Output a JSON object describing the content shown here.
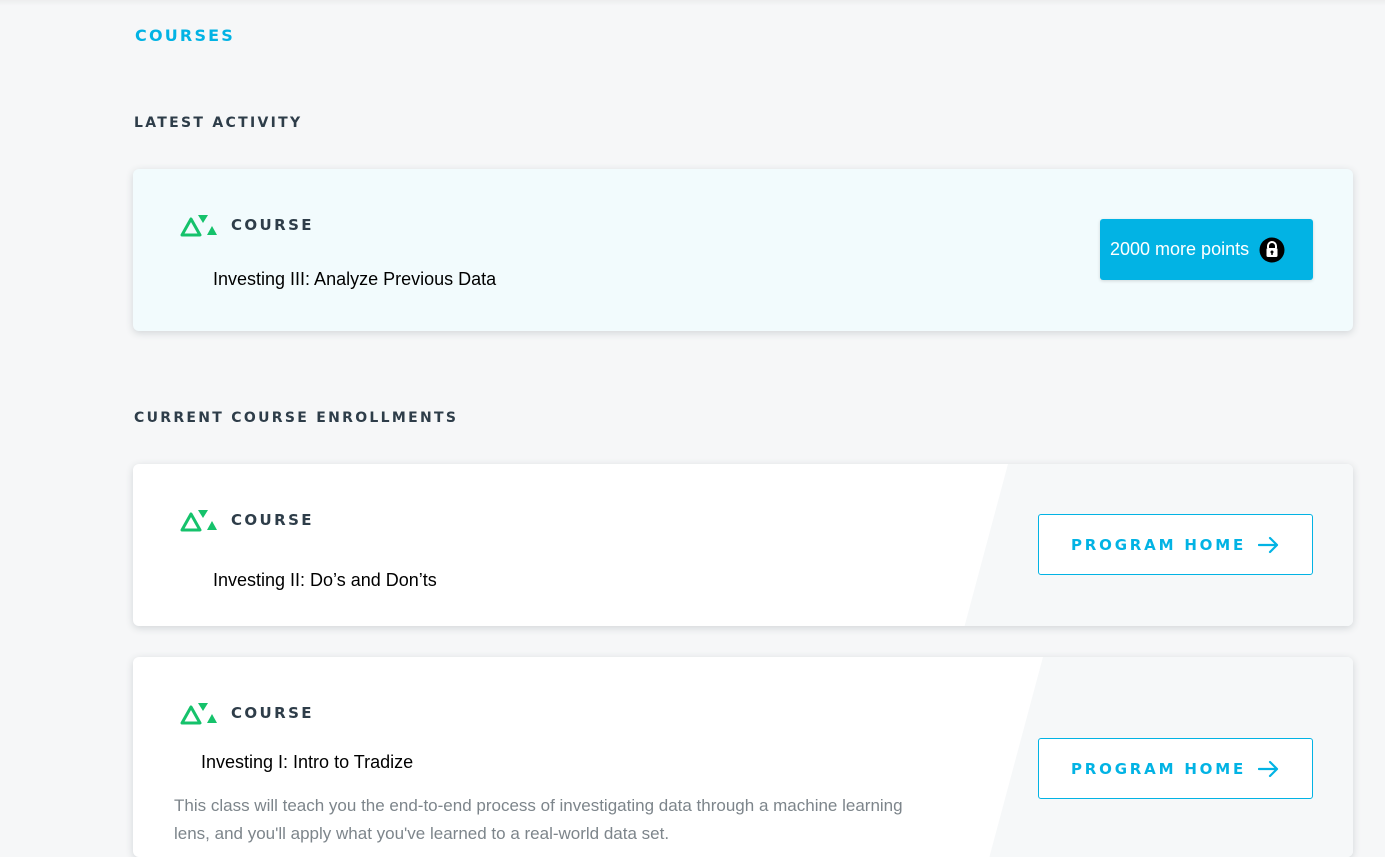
{
  "nav": {
    "courses_link": "COURSES"
  },
  "latest_activity": {
    "heading": "LATEST ACTIVITY",
    "card": {
      "tag": "COURSE",
      "title": "Investing III:  Analyze Previous Data",
      "locked_label": "2000 more points",
      "icon": "lock-icon"
    }
  },
  "enrollments": {
    "heading": "CURRENT COURSE ENROLLMENTS",
    "items": [
      {
        "tag": "COURSE",
        "title": "Investing II:  Do’s and Don’ts",
        "button_label": "PROGRAM HOME"
      },
      {
        "tag": "COURSE",
        "title": "Investing I:  Intro to Tradize",
        "description": "This class will teach you the end-to-end process of investigating data through a machine learning lens, and you'll apply what you've learned to a real-world data set.",
        "button_label": "PROGRAM HOME"
      }
    ]
  },
  "colors": {
    "accent": "#02b3e4",
    "brand_green": "#15c26b",
    "text": "#2e3d49",
    "muted": "#7d858b"
  }
}
